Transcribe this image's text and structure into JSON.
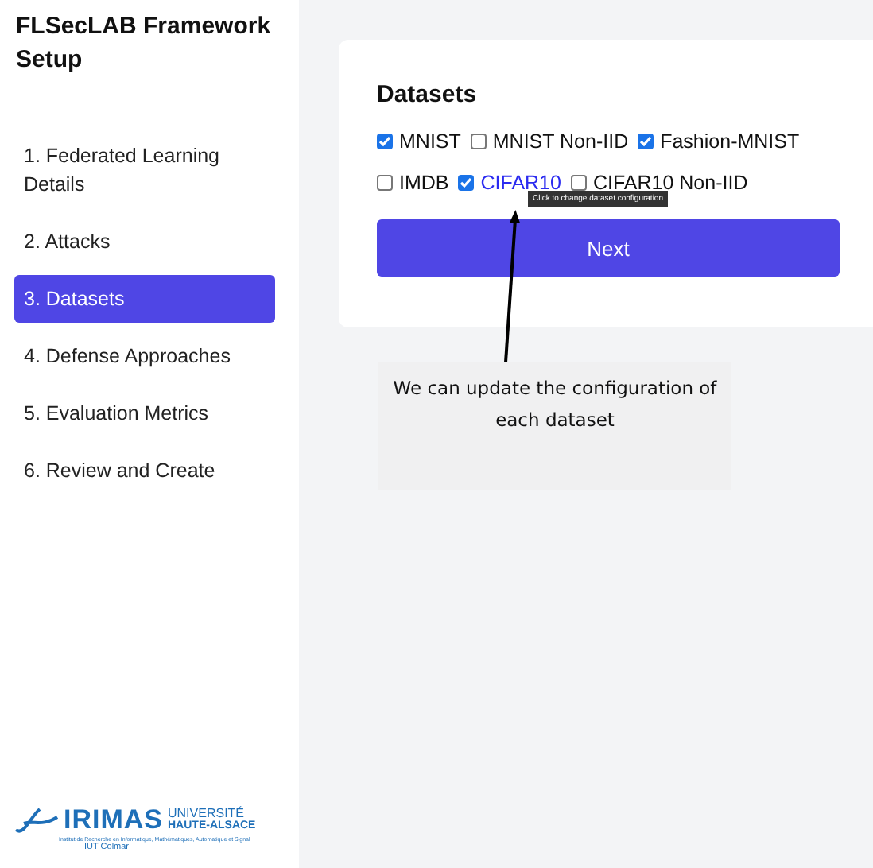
{
  "sidebar": {
    "title": "FLSecLAB Framework Setup",
    "steps": [
      {
        "label": "1. Federated Learning Details",
        "selected": false
      },
      {
        "label": "2. Attacks",
        "selected": false
      },
      {
        "label": "3. Datasets",
        "selected": true
      },
      {
        "label": "4. Defense Approaches",
        "selected": false
      },
      {
        "label": "5. Evaluation Metrics",
        "selected": false
      },
      {
        "label": "6. Review and Create",
        "selected": false
      }
    ],
    "logo": {
      "name": "IRIMAS",
      "university": "UNIVERSITÉ",
      "region": "HAUTE-ALSACE",
      "subtitle": "Institut de Recherche en Informatique, Mathématiques, Automatique et Signal",
      "school": "IUT Colmar"
    }
  },
  "card": {
    "title": "Datasets",
    "datasets": [
      {
        "label": "MNIST",
        "checked": true,
        "kind": "plain"
      },
      {
        "label": "MNIST Non-IID",
        "checked": false,
        "kind": "plain"
      },
      {
        "label": "Fashion-MNIST",
        "checked": true,
        "kind": "plain"
      },
      {
        "label": "IMDB",
        "checked": false,
        "kind": "plain"
      },
      {
        "label": "CIFAR10",
        "checked": true,
        "kind": "link"
      },
      {
        "label": "CIFAR10 Non-IID",
        "checked": false,
        "kind": "plain"
      }
    ],
    "tooltip": "Click to change dataset configuration",
    "button": "Next"
  },
  "annotation": {
    "text": "We can update the configuration of each dataset"
  }
}
